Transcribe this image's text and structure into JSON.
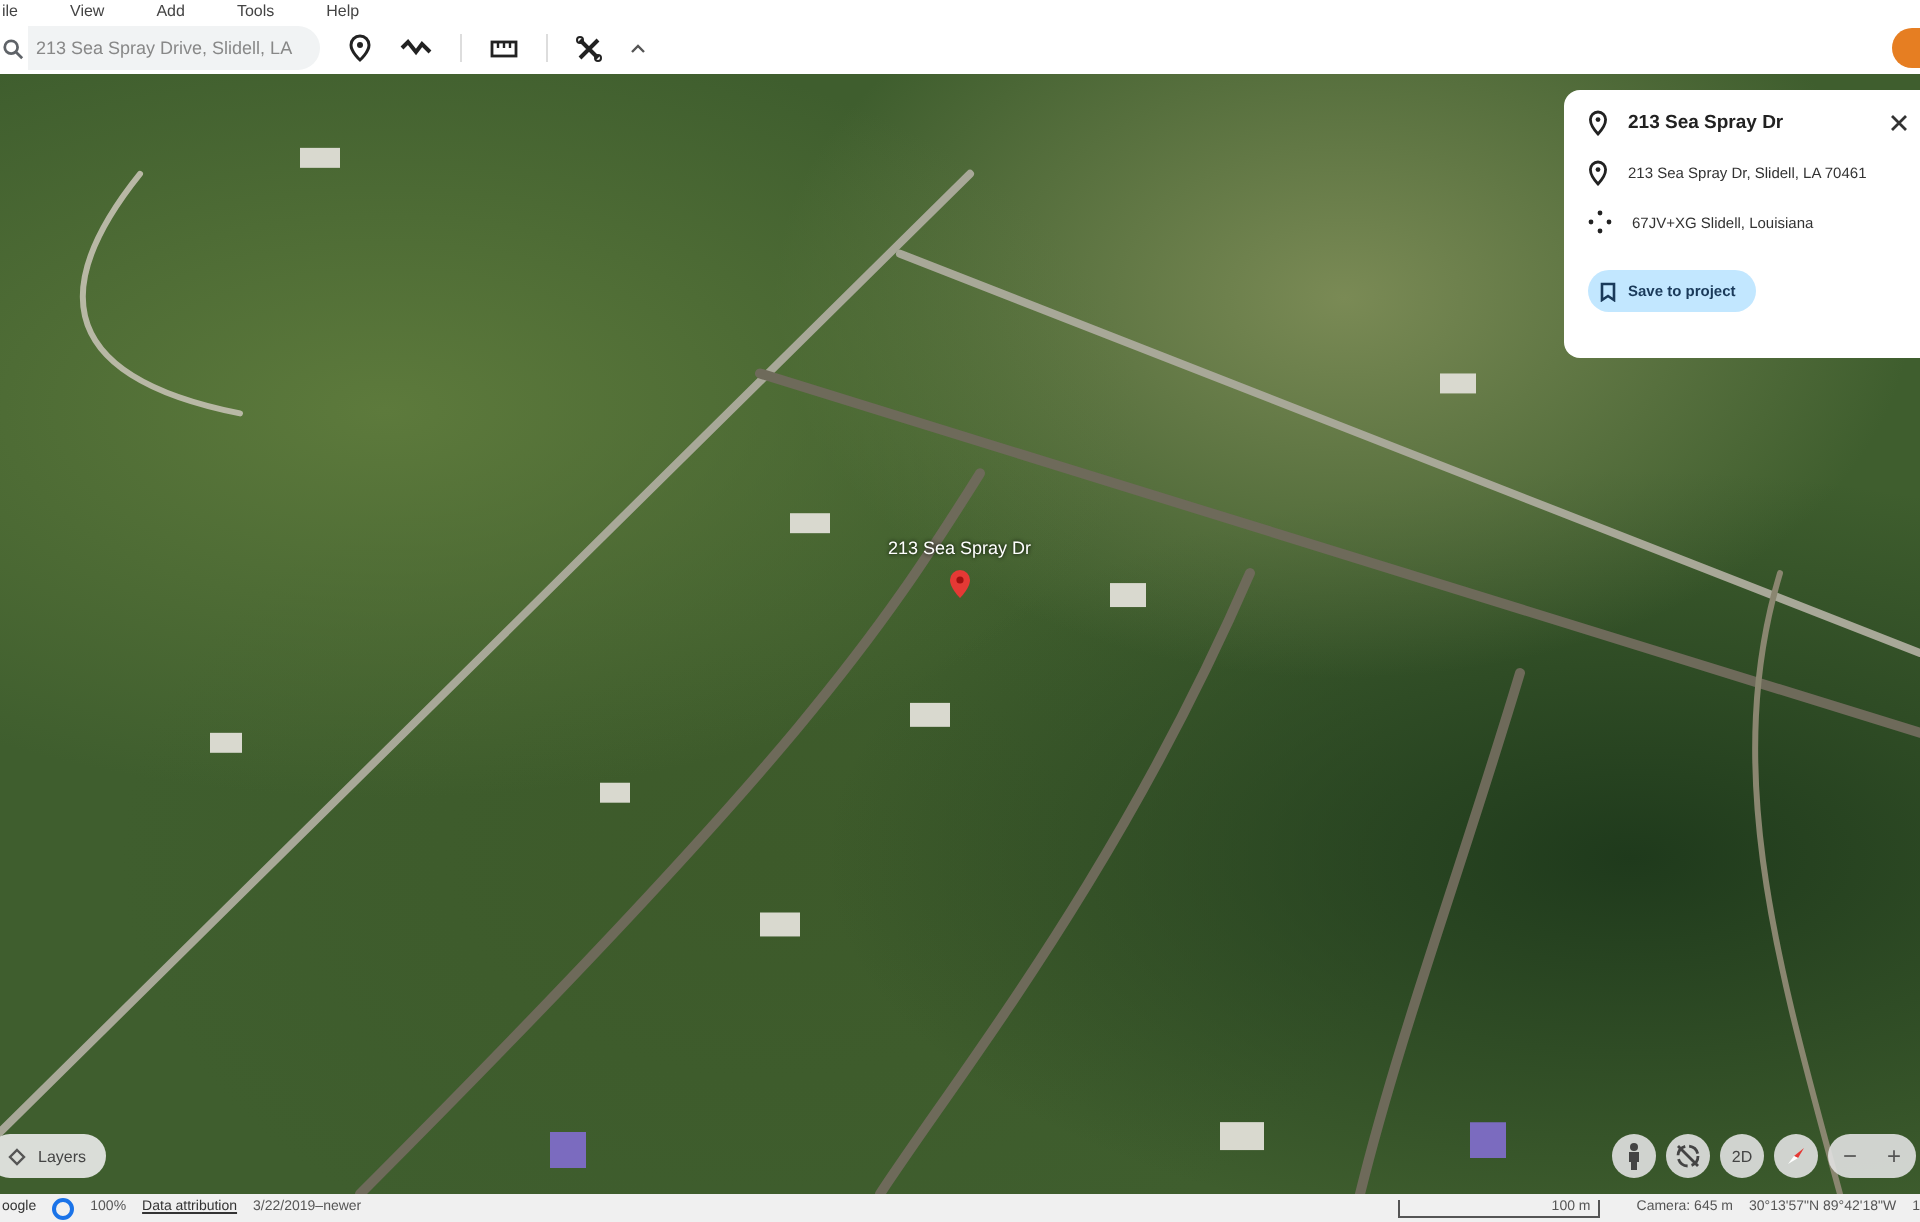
{
  "menu": [
    "ile",
    "View",
    "Add",
    "Tools",
    "Help"
  ],
  "search": {
    "value": "213 Sea Spray Drive, Slidell, LA"
  },
  "map": {
    "place_label": "213 Sea Spray Dr"
  },
  "place_card": {
    "title": "213 Sea Spray Dr",
    "address": "213 Sea Spray Dr, Slidell, LA 70461",
    "plus_code": "67JV+XG Slidell, Louisiana",
    "save_button": "Save to project"
  },
  "layers_button": "Layers",
  "view_buttons": [
    "2D",
    "−",
    "+"
  ],
  "status_bar": {
    "logo": "oogle",
    "zoom": "100%",
    "attribution": "Data attribution",
    "imagery_date": "3/22/2019–newer",
    "scale": "100 m",
    "camera": "Camera: 645 m",
    "coordinates": "30°13'57\"N 89°42'18\"W",
    "cut_text": "1"
  }
}
